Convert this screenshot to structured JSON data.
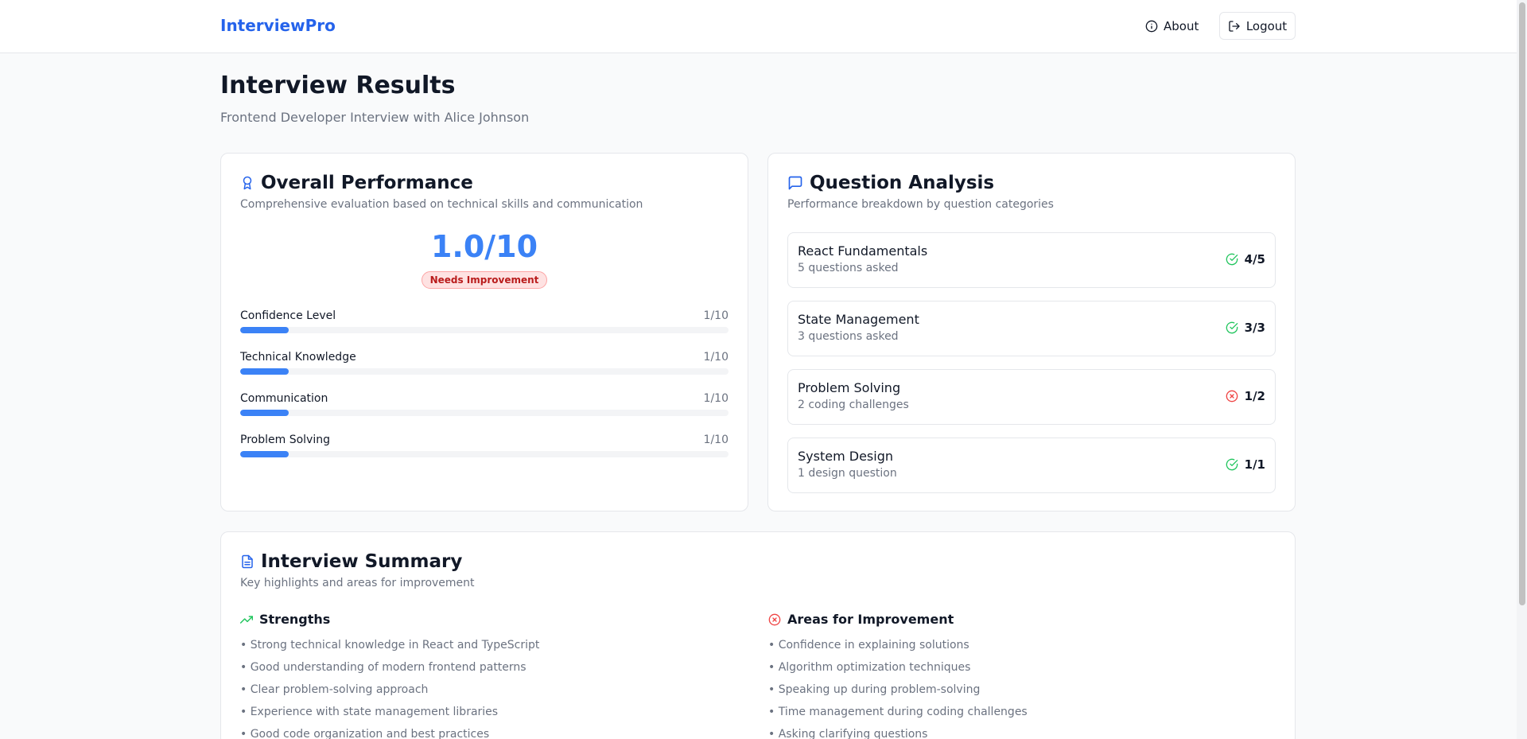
{
  "header": {
    "brand": "InterviewPro",
    "about_label": "About",
    "logout_label": "Logout"
  },
  "page": {
    "title": "Interview Results",
    "subtitle": "Frontend Developer Interview with Alice Johnson"
  },
  "overall": {
    "title": "Overall Performance",
    "description": "Comprehensive evaluation based on technical skills and communication",
    "score": "1.0/10",
    "badge": "Needs Improvement",
    "metrics": [
      {
        "label": "Confidence Level",
        "value": "1/10",
        "fraction": 0.1
      },
      {
        "label": "Technical Knowledge",
        "value": "1/10",
        "fraction": 0.1
      },
      {
        "label": "Communication",
        "value": "1/10",
        "fraction": 0.1
      },
      {
        "label": "Problem Solving",
        "value": "1/10",
        "fraction": 0.1
      }
    ]
  },
  "analysis": {
    "title": "Question Analysis",
    "description": "Performance breakdown by question categories",
    "items": [
      {
        "name": "React Fundamentals",
        "detail": "5 questions asked",
        "score": "4/5",
        "status": "pass"
      },
      {
        "name": "State Management",
        "detail": "3 questions asked",
        "score": "3/3",
        "status": "pass"
      },
      {
        "name": "Problem Solving",
        "detail": "2 coding challenges",
        "score": "1/2",
        "status": "fail"
      },
      {
        "name": "System Design",
        "detail": "1 design question",
        "score": "1/1",
        "status": "pass"
      }
    ]
  },
  "summary": {
    "title": "Interview Summary",
    "description": "Key highlights and areas for improvement",
    "strengths_title": "Strengths",
    "strengths": [
      "• Strong technical knowledge in React and TypeScript",
      "• Good understanding of modern frontend patterns",
      "• Clear problem-solving approach",
      "• Experience with state management libraries",
      "• Good code organization and best practices"
    ],
    "improvements_title": "Areas for Improvement",
    "improvements": [
      "• Confidence in explaining solutions",
      "• Algorithm optimization techniques",
      "• Speaking up during problem-solving",
      "• Time management during coding challenges",
      "• Asking clarifying questions"
    ]
  },
  "colors": {
    "brand": "#2563eb",
    "progress": "#3b82f6",
    "pass": "#22c55e",
    "fail": "#ef4444",
    "badge_bg": "#fee2e2"
  },
  "icons": {
    "about": "info-icon",
    "logout": "logout-icon",
    "overall": "award-icon",
    "analysis": "message-square-icon",
    "summary": "file-text-icon",
    "strengths": "trending-up-icon",
    "improvements": "x-circle-icon",
    "pass": "check-circle-icon",
    "fail": "x-circle-icon"
  }
}
